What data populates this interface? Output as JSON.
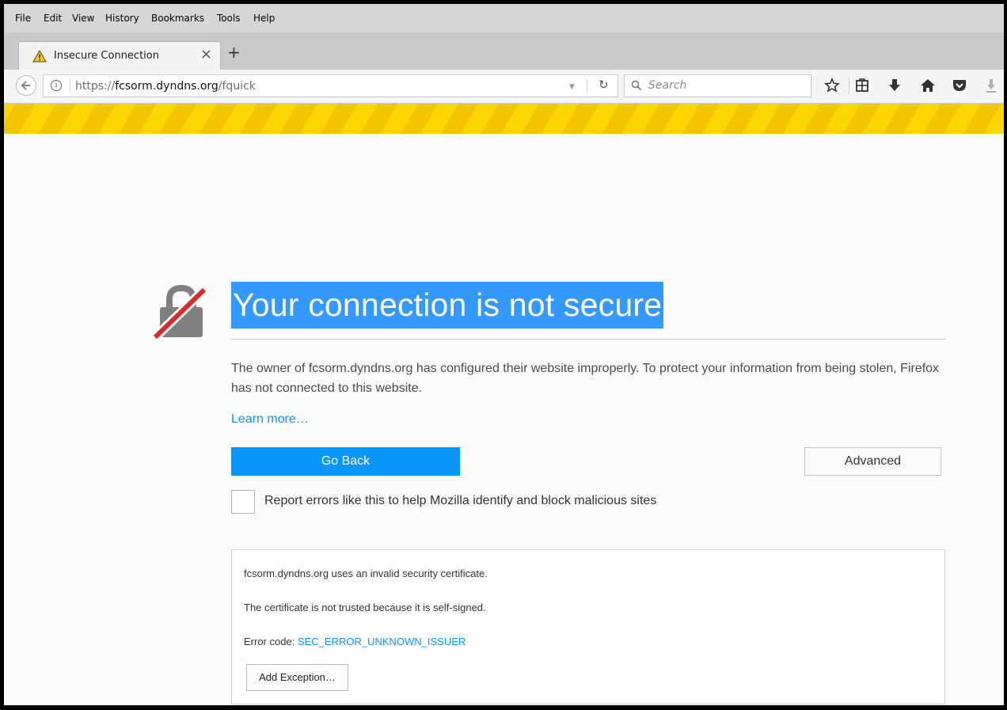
{
  "menubar": {
    "items": [
      "File",
      "Edit",
      "View",
      "History",
      "Bookmarks",
      "Tools",
      "Help"
    ]
  },
  "tab": {
    "title": "Insecure Connection",
    "icon": "warning-triangle-icon"
  },
  "navbar": {
    "url_scheme": "https://",
    "url_host": "fcsorm.dyndns.org",
    "url_path": "/fquick",
    "search_placeholder": "Search"
  },
  "colors": {
    "title_highlight": "#3399ff",
    "accent_blue": "#0996f8",
    "warning_stripe_a": "#ffd700",
    "warning_stripe_b": "#f5c400"
  },
  "error_page": {
    "title": "Your connection is not secure",
    "description": "The owner of fcsorm.dyndns.org has configured their website improperly. To protect your information from being stolen, Firefox has not connected to this website.",
    "learn_more": "Learn more…",
    "go_back": "Go Back",
    "advanced": "Advanced",
    "report_label": "Report errors like this to help Mozilla identify and block malicious sites",
    "report_checked": false
  },
  "advanced_panel": {
    "line1": "fcsorm.dyndns.org uses an invalid security certificate.",
    "line2": "The certificate is not trusted because it is self-signed.",
    "error_code_label": "Error code: ",
    "error_code": "SEC_ERROR_UNKNOWN_ISSUER",
    "add_exception": "Add Exception…"
  }
}
